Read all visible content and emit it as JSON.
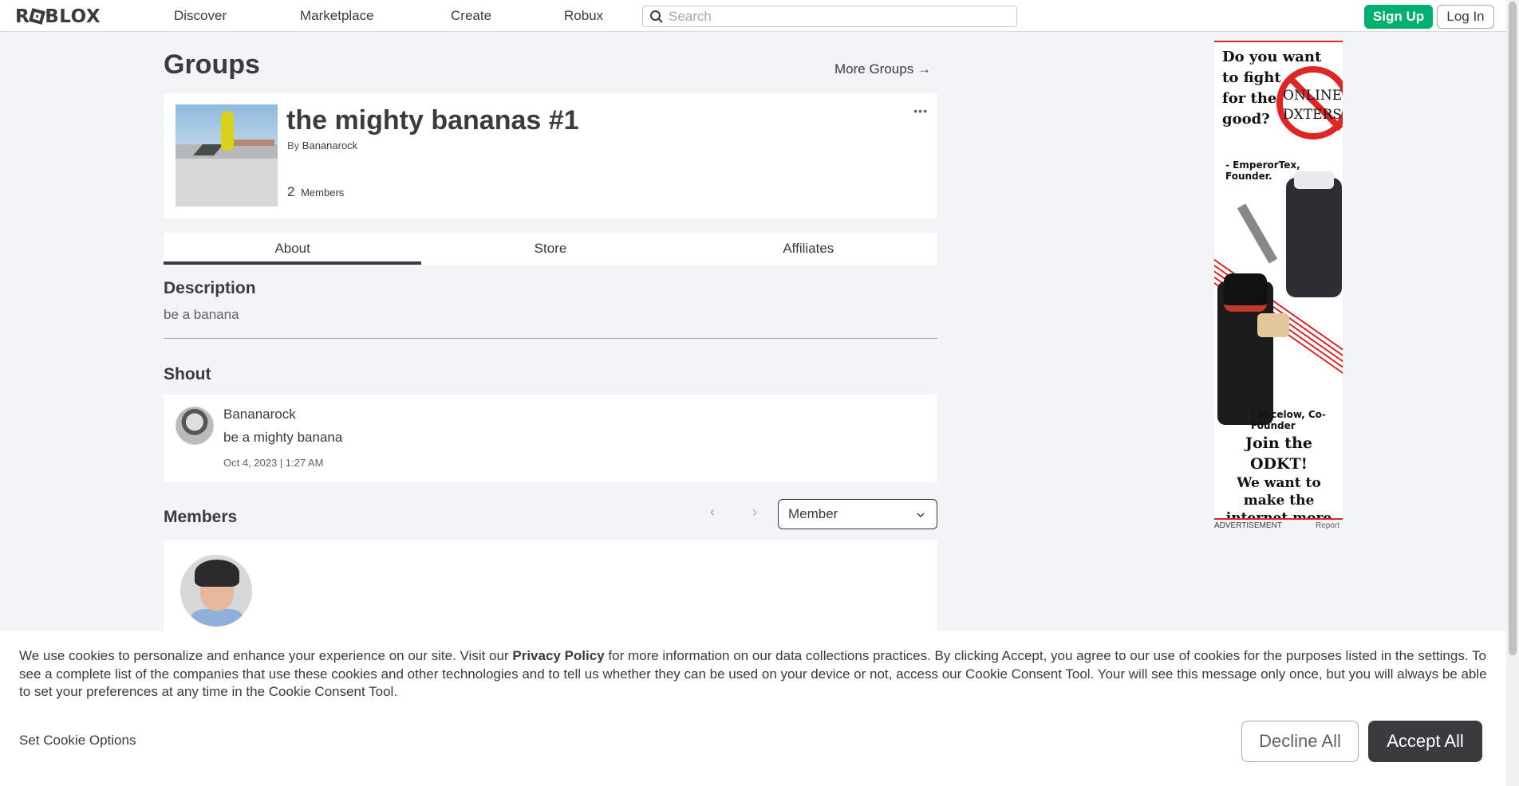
{
  "nav": {
    "logo": "ROBLOX",
    "links": [
      "Discover",
      "Marketplace",
      "Create",
      "Robux"
    ],
    "search_placeholder": "Search",
    "signup_label": "Sign Up",
    "login_label": "Log In"
  },
  "page": {
    "title": "Groups",
    "more_groups": "More Groups →"
  },
  "group": {
    "name": "the mighty bananas #1",
    "by_label": "By",
    "owner": "Bananarock",
    "member_count": "2",
    "members_label": "Members",
    "more_icon": "•••"
  },
  "tabs": [
    {
      "label": "About",
      "active": true
    },
    {
      "label": "Store",
      "active": false
    },
    {
      "label": "Affiliates",
      "active": false
    }
  ],
  "description": {
    "heading": "Description",
    "text": "be a banana"
  },
  "shout": {
    "heading": "Shout",
    "user": "Bananarock",
    "message": "be a mighty banana",
    "date": "Oct 4, 2023 | 1:27 AM"
  },
  "members": {
    "heading": "Members",
    "prev_icon": "‹",
    "next_icon": "›",
    "role_selected": "Member"
  },
  "ad": {
    "top_lines": [
      "Do you want",
      "to fight",
      "for the",
      "good?"
    ],
    "sign_lines": [
      "ONLINE",
      "DXTERS"
    ],
    "quote1": "- EmperorTex, Founder.",
    "quote2": "- Micelow, Co-Founder",
    "bottom_l1": "Join the ODKT!",
    "bottom_l2": "We want to make the internet more safe for everyone.",
    "label": "ADVERTISEMENT",
    "report": "Report"
  },
  "cookie": {
    "text_before": "We use cookies to personalize and enhance your experience on our site. Visit our ",
    "policy_link": "Privacy Policy",
    "text_after": " for more information on our data collections practices. By clicking Accept, you agree to our use of cookies for the purposes listed in the settings. To see a complete list of the companies that use these cookies and other technologies and to tell us whether they can be used on your device or not, access our Cookie Consent Tool. Your will see this message only once, but you will always be able to set your preferences at any time in the Cookie Consent Tool.",
    "set_options": "Set Cookie Options",
    "decline": "Decline All",
    "accept": "Accept All"
  },
  "colors": {
    "signup_green": "#00b06f",
    "accept_dark": "#393b3d",
    "background": "#f2f4f5",
    "ad_red": "#e02525"
  }
}
